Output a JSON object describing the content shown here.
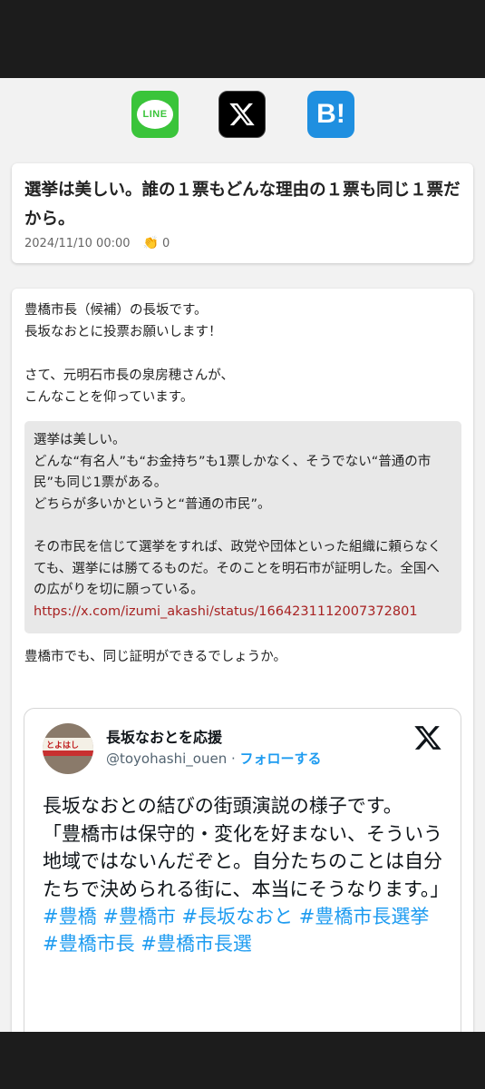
{
  "share": {
    "line_label": "LINE",
    "hatena_label": "B!"
  },
  "post": {
    "title": "選挙は美しい。誰の１票もどんな理由の１票も同じ１票だから。",
    "date": "2024/11/10 00:00",
    "claps": "0"
  },
  "body": {
    "para1_line1": "豊橋市長（候補）の長坂です。",
    "para1_line2": "長坂なおとに投票お願いします！",
    "para2_line1": "さて、元明石市長の泉房穂さんが、",
    "para2_line2": "こんなことを仰っています。",
    "quote_line1": "選挙は美しい。",
    "quote_line2": "どんな“有名人”も“お金持ち”も1票しかなく、そうでない“普通の市民”も同じ1票がある。",
    "quote_line3": "どちらが多いかというと“普通の市民”。",
    "quote_line4": "その市民を信じて選挙をすれば、政党や団体といった組織に頼らなくても、選挙には勝てるものだ。そのことを明石市が証明した。全国への広がりを切に願っている。",
    "quote_link": "https://x.com/izumi_akashi/status/1664231112007372801",
    "after": "豊橋市でも、同じ証明ができるでしょうか。"
  },
  "embed": {
    "avatar_text": "とよはし",
    "name": "長坂なおとを応援",
    "handle": "@toyohashi_ouen",
    "separator": " · ",
    "follow": "フォローする",
    "tweet": "長坂なおとの結びの街頭演説の様子です。\n「豊橋市は保守的・変化を好まない、そういう地域ではないんだぞと。自分たちのことは自分たちで決められる街に、本当にそうなります。」",
    "hashtags": "#豊橋 #豊橋市 #長坂なおと #豊橋市長選挙 #豊橋市長 #豊橋市長選"
  },
  "colors": {
    "line_green": "#3ac43a",
    "hatena_blue": "#1f8fe0",
    "link_red": "#a82222",
    "twitter_blue": "#1d9bf0"
  },
  "icons": [
    "line-icon",
    "x-icon",
    "hatena-bookmark-icon",
    "clap-icon",
    "x-logo-icon"
  ]
}
